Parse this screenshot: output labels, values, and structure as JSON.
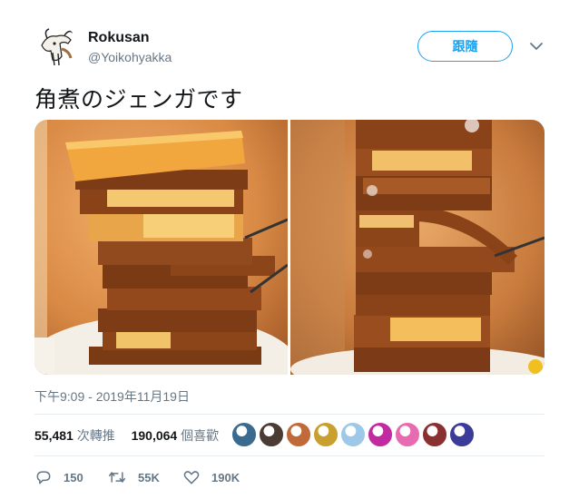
{
  "user": {
    "name": "Rokusan",
    "handle": "@Yoikohyakka"
  },
  "follow_label": "跟隨",
  "tweet_text": "角煮のジェンガです",
  "timestamp": "下午9:09 - 2019年11月19日",
  "stats": {
    "retweets_count": "55,481",
    "retweets_label": "次轉推",
    "likes_count": "190,064",
    "likes_label": "個喜歡"
  },
  "actions": {
    "reply_count": "150",
    "retweet_count": "55K",
    "like_count": "190K"
  },
  "icons": [
    "caret-down-icon",
    "reply-icon",
    "retweet-icon",
    "heart-icon"
  ],
  "colors": {
    "accent": "#1da1f2",
    "secondary_text": "#657786",
    "primary_text": "#14171a"
  },
  "likers_colors": [
    "#3b6a8f",
    "#4a3b33",
    "#c06a3a",
    "#c9a030",
    "#9ec8e8",
    "#c12aa0",
    "#e86ab0",
    "#8a3030",
    "#3b3b9a"
  ]
}
